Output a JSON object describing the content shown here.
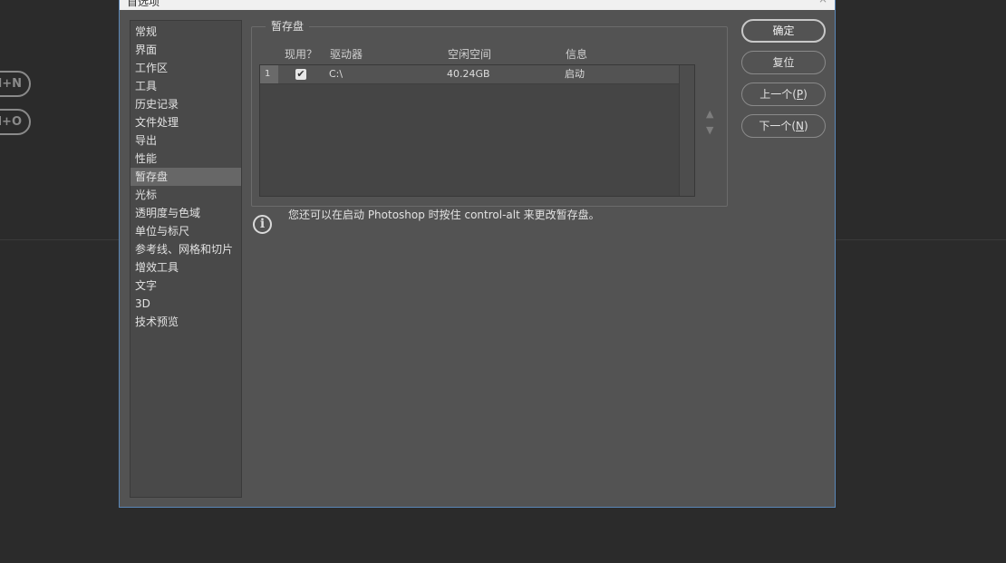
{
  "background": {
    "shortcut_1": "l+N",
    "shortcut_2": "l+O"
  },
  "dialog": {
    "title": "首选项",
    "close": "×"
  },
  "sidebar": {
    "items": [
      {
        "label": "常规"
      },
      {
        "label": "界面"
      },
      {
        "label": "工作区"
      },
      {
        "label": "工具"
      },
      {
        "label": "历史记录"
      },
      {
        "label": "文件处理"
      },
      {
        "label": "导出"
      },
      {
        "label": "性能"
      },
      {
        "label": "暂存盘",
        "selected": true
      },
      {
        "label": "光标"
      },
      {
        "label": "透明度与色域"
      },
      {
        "label": "单位与标尺"
      },
      {
        "label": "参考线、网格和切片"
      },
      {
        "label": "增效工具"
      },
      {
        "label": "文字"
      },
      {
        "label": "3D"
      },
      {
        "label": "技术预览"
      }
    ]
  },
  "scratch": {
    "group_title": "暂存盘",
    "columns": {
      "active": "现用？",
      "drive": "驱动器",
      "free": "空闲空间",
      "info": "信息"
    },
    "rows": [
      {
        "index": "1",
        "active_check": "✔",
        "drive": "C:\\",
        "free": "40.24GB",
        "info": "启动"
      }
    ],
    "up_arrow": "▲",
    "down_arrow": "▼"
  },
  "info": {
    "icon": "i",
    "text": "您还可以在启动 Photoshop 时按住 control-alt 来更改暂存盘。"
  },
  "buttons": {
    "ok": "确定",
    "reset": "复位",
    "prev": "上一个(",
    "prev_key": "P",
    "next": "下一个(",
    "next_key": "N",
    "close_paren": ")"
  }
}
